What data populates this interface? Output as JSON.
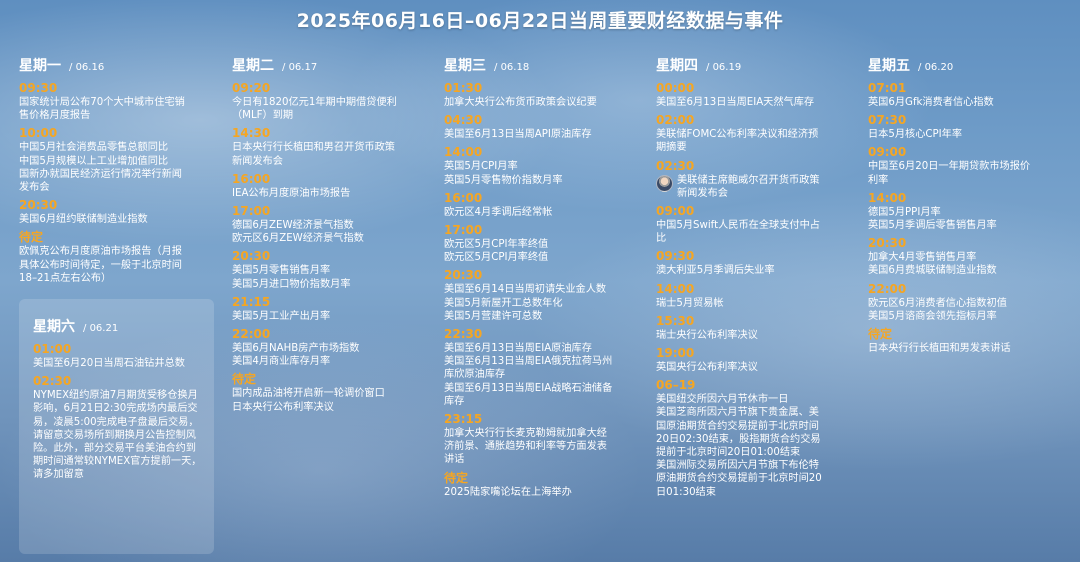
{
  "title": "2025年06月16日–06月22日当周重要财经数据与事件",
  "days": [
    {
      "name": "星期一",
      "date": "06.16",
      "slots": [
        {
          "time": "09:30",
          "events": [
            "国家统计局公布70个大中城市住宅销售价格月度报告"
          ]
        },
        {
          "time": "10:00",
          "events": [
            "中国5月社会消费品零售总额同比",
            "中国5月规模以上工业增加值同比",
            "国新办就国民经济运行情况举行新闻发布会"
          ]
        },
        {
          "time": "20:30",
          "events": [
            "美国6月纽约联储制造业指数"
          ]
        },
        {
          "time": "待定",
          "events": [
            "欧佩克公布月度原油市场报告（月报具体公布时间待定，一般于北京时间18–21点左右公布）"
          ]
        }
      ]
    },
    {
      "name": "星期二",
      "date": "06.17",
      "slots": [
        {
          "time": "09:20",
          "events": [
            "今日有1820亿元1年期中期借贷便利（MLF）到期"
          ]
        },
        {
          "time": "14:30",
          "events": [
            "日本央行行长植田和男召开货币政策新闻发布会"
          ]
        },
        {
          "time": "16:00",
          "events": [
            "IEA公布月度原油市场报告"
          ]
        },
        {
          "time": "17:00",
          "events": [
            "德国6月ZEW经济景气指数",
            "欧元区6月ZEW经济景气指数"
          ]
        },
        {
          "time": "20:30",
          "events": [
            "美国5月零售销售月率",
            "美国5月进口物价指数月率"
          ]
        },
        {
          "time": "21:15",
          "events": [
            "美国5月工业产出月率"
          ]
        },
        {
          "time": "22:00",
          "events": [
            "美国6月NAHB房产市场指数",
            "美国4月商业库存月率"
          ]
        },
        {
          "time": "待定",
          "events": [
            "国内成品油将开启新一轮调价窗口",
            "日本央行公布利率决议"
          ]
        }
      ]
    },
    {
      "name": "星期三",
      "date": "06.18",
      "slots": [
        {
          "time": "01:30",
          "events": [
            "加拿大央行公布货币政策会议纪要"
          ]
        },
        {
          "time": "04:30",
          "events": [
            "美国至6月13日当周API原油库存"
          ]
        },
        {
          "time": "14:00",
          "events": [
            "英国5月CPI月率",
            "英国5月零售物价指数月率"
          ]
        },
        {
          "time": "16:00",
          "events": [
            "欧元区4月季调后经常帐"
          ]
        },
        {
          "time": "17:00",
          "events": [
            "欧元区5月CPI年率终值",
            "欧元区5月CPI月率终值"
          ]
        },
        {
          "time": "20:30",
          "events": [
            "美国至6月14日当周初请失业金人数",
            "美国5月新屋开工总数年化",
            "美国5月营建许可总数"
          ]
        },
        {
          "time": "22:30",
          "events": [
            "美国至6月13日当周EIA原油库存",
            "美国至6月13日当周EIA俄克拉荷马州库欣原油库存",
            "美国至6月13日当周EIA战略石油储备库存"
          ]
        },
        {
          "time": "23:15",
          "events": [
            "加拿大央行行长麦克勒姆就加拿大经济前景、通胀趋势和利率等方面发表讲话"
          ]
        },
        {
          "time": "待定",
          "events": [
            "2025陆家嘴论坛在上海举办"
          ]
        }
      ]
    },
    {
      "name": "星期四",
      "date": "06.19",
      "slots": [
        {
          "time": "00:00",
          "events": [
            "美国至6月13日当周EIA天然气库存"
          ]
        },
        {
          "time": "02:00",
          "events": [
            "美联储FOMC公布利率决议和经济预期摘要"
          ]
        },
        {
          "time": "02:30",
          "avatar": true,
          "events": [
            "美联储主席鲍威尔召开货币政策新闻发布会"
          ]
        },
        {
          "time": "09:00",
          "events": [
            "中国5月Swift人民币在全球支付中占比"
          ]
        },
        {
          "time": "09:30",
          "events": [
            "澳大利亚5月季调后失业率"
          ]
        },
        {
          "time": "14:00",
          "events": [
            "瑞士5月贸易帐"
          ]
        },
        {
          "time": "15:30",
          "events": [
            "瑞士央行公布利率决议"
          ]
        },
        {
          "time": "19:00",
          "events": [
            "英国央行公布利率决议"
          ]
        },
        {
          "time": "06–19",
          "events": [
            "美国纽交所因六月节休市一日",
            "美国芝商所因六月节旗下贵金属、美国原油期货合约交易提前于北京时间20日02:30结束，股指期货合约交易提前于北京时间20日01:00结束",
            "美国洲际交易所因六月节旗下布伦特原油期货合约交易提前于北京时间20日01:30结束"
          ]
        }
      ]
    },
    {
      "name": "星期五",
      "date": "06.20",
      "slots": [
        {
          "time": "07:01",
          "events": [
            "英国6月Gfk消费者信心指数"
          ]
        },
        {
          "time": "07:30",
          "events": [
            "日本5月核心CPI年率"
          ]
        },
        {
          "time": "09:00",
          "events": [
            "中国至6月20日一年期贷款市场报价利率"
          ]
        },
        {
          "time": "14:00",
          "events": [
            "德国5月PPI月率",
            "英国5月季调后零售销售月率"
          ]
        },
        {
          "time": "20:30",
          "events": [
            "加拿大4月零售销售月率",
            "美国6月费城联储制造业指数"
          ]
        },
        {
          "time": "22:00",
          "events": [
            "欧元区6月消费者信心指数初值",
            "美国5月谘商会领先指标月率"
          ]
        },
        {
          "time": "待定",
          "events": [
            "日本央行行长植田和男发表讲话"
          ]
        }
      ]
    },
    {
      "name": "星期六",
      "date": "06.21",
      "slots": [
        {
          "time": "01:00",
          "events": [
            "美国至6月20日当周石油钻井总数"
          ]
        },
        {
          "time": "02:30",
          "events": [
            "NYMEX纽约原油7月期货受移仓换月影响，6月21日2:30完成场内最后交易，凌晨5:00完成电子盘最后交易，请留意交易场所到期换月公告控制风险。此外，部分交易平台美油合约到期时间通常较NYMEX官方提前一天，请多加留意"
          ]
        }
      ]
    }
  ]
}
